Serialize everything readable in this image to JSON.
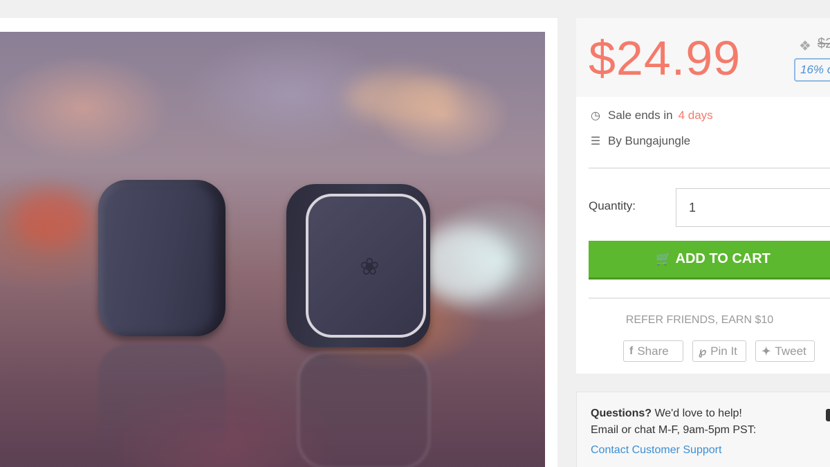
{
  "product": {
    "image_alt": "Two square magnetic mounts on a table",
    "logo_icon": "palm-tree-icon"
  },
  "purchase": {
    "price": "$24.99",
    "old_price": "$2",
    "discount": "16% o",
    "sale_prefix": "Sale ends in",
    "sale_time": "4 days",
    "by_label": "By Bungajungle",
    "quantity_label": "Quantity:",
    "quantity_value": "1",
    "add_to_cart": "ADD TO CART",
    "refer": "REFER FRIENDS, EARN $10",
    "share": "Share",
    "pin": "Pin It",
    "tweet": "Tweet",
    "accent_color": "#f47b6b",
    "button_color": "#5cb82e"
  },
  "support": {
    "question_bold": "Questions?",
    "question_rest": "We'd love to help!",
    "hours": "Email or chat M-F, 9am-5pm PST:",
    "link": "Contact Customer Support"
  },
  "icons": {
    "clock": "clock-icon",
    "layers": "layers-icon",
    "tag": "tag-icon",
    "cart": "cart-icon",
    "facebook": "facebook-icon",
    "pinterest": "pinterest-icon",
    "twitter": "twitter-icon"
  }
}
